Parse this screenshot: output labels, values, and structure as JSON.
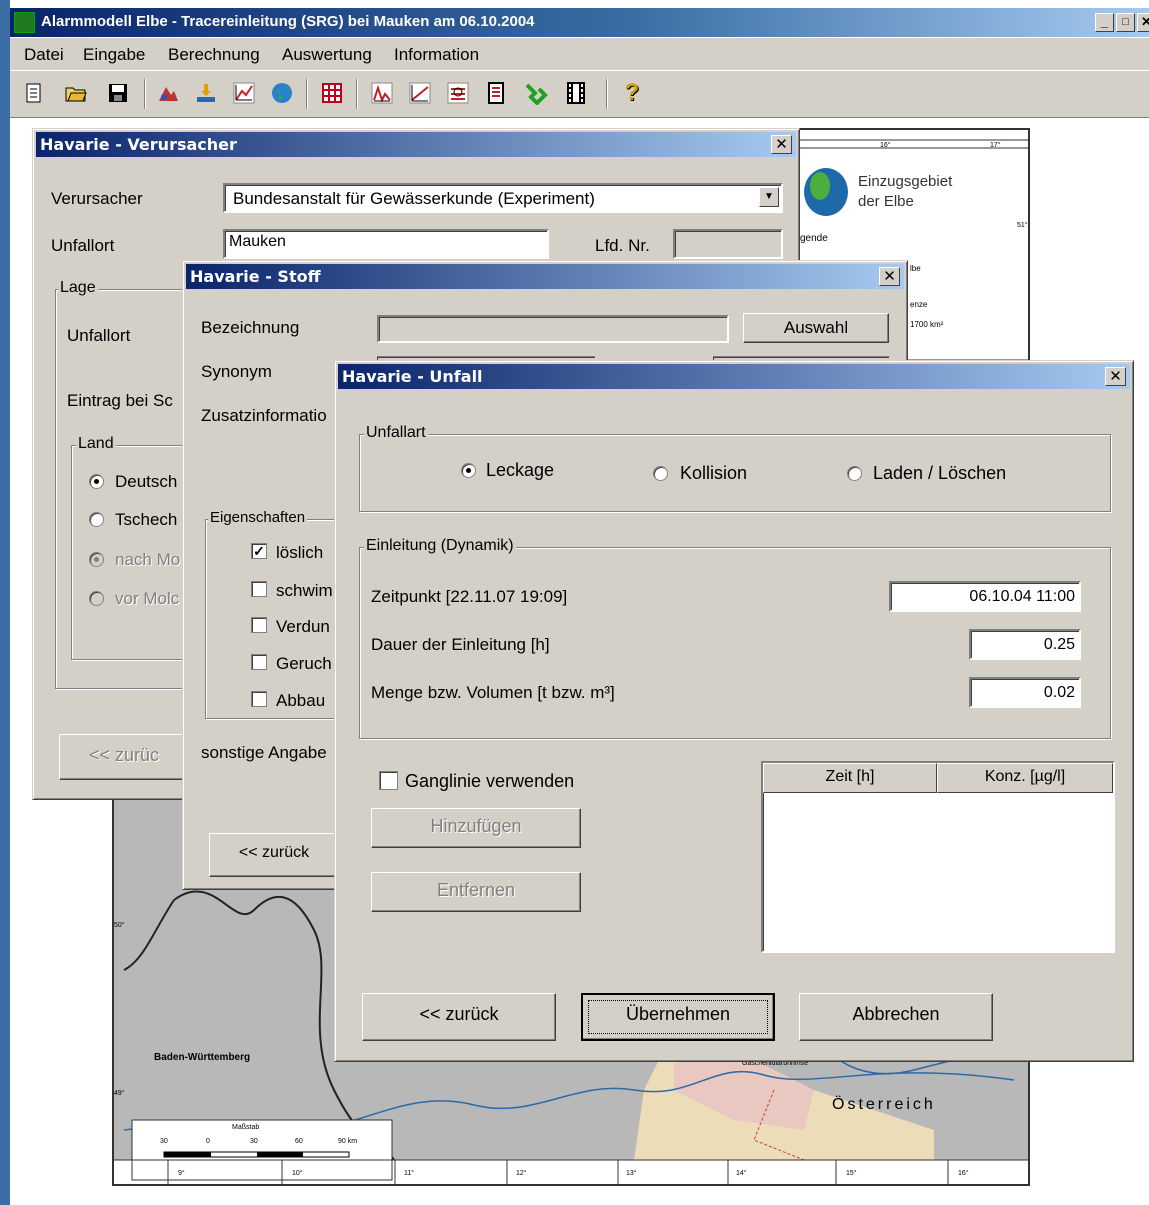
{
  "window": {
    "title": "Alarmmodell Elbe - Tracereinleitung (SRG) bei Mauken am 06.10.2004",
    "min_label": "_",
    "max_label": "□",
    "close_label": "✕"
  },
  "menu": [
    "Datei",
    "Eingabe",
    "Berechnung",
    "Auswertung",
    "Information"
  ],
  "toolbar": {
    "icons": [
      "new-doc-icon",
      "open-folder-icon",
      "save-icon",
      "river-source-icon",
      "inflow-icon",
      "graph-icon",
      "globe-icon",
      "table-icon",
      "chart-peak-icon",
      "chart-line-icon",
      "chart-stack-icon",
      "report-icon",
      "route-icon",
      "film-icon",
      "help-icon"
    ],
    "help_glyph": "?"
  },
  "map": {
    "legend_title_1": "Einzugsgebiet",
    "legend_title_2": "der Elbe",
    "legend_line": "gende",
    "legend_elbe": "lbe",
    "legend_enze": "enze",
    "legend_area": "1700 km²",
    "region_bw": "Baden-Württemberg",
    "region_at": "Österreich",
    "scale_title": "Maßstab",
    "scale_ticks": [
      "30",
      "0",
      "30",
      "60",
      "90 km"
    ],
    "lon_ticks": [
      "9°",
      "10°",
      "11°",
      "12°",
      "13°",
      "14°",
      "15°",
      "16°"
    ],
    "lat_ticks": [
      "50°",
      "49°"
    ],
    "top_ticks": [
      "16°",
      "17°"
    ],
    "lat_right": "51°",
    "city_label": "Gaschenidlarbhrimse"
  },
  "dialog_verursacher": {
    "title": "Havarie - Verursacher",
    "close": "✕",
    "verursacher_label": "Verursacher",
    "verursacher_value": "Bundesanstalt für Gewässerkunde (Experiment)",
    "unfallort_label": "Unfallort",
    "unfallort_value": "Mauken",
    "lfd_label": "Lfd. Nr.",
    "lfd_value": "",
    "lage_group": "Lage",
    "lage_unfallort": "Unfallort",
    "eintrag_label": "Eintrag bei Sc",
    "land_group": "Land",
    "land_options": [
      "Deutsch",
      "Tschech",
      "nach Mo",
      "vor Molc"
    ],
    "back_button": "<< zurüc"
  },
  "dialog_stoff": {
    "title": "Havarie - Stoff",
    "close": "✕",
    "bezeichnung_label": "Bezeichnung",
    "bezeichnung_value": "",
    "auswahl_button": "Auswahl",
    "synonym_label": "Synonym",
    "zusatz_label": "Zusatzinformatio",
    "eigenschaften_group": "Eigenschaften",
    "checks": [
      {
        "label": "löslich",
        "checked": true
      },
      {
        "label": "schwim",
        "checked": false
      },
      {
        "label": "Verdun",
        "checked": false
      },
      {
        "label": "Geruch",
        "checked": false
      },
      {
        "label": "Abbau",
        "checked": false
      }
    ],
    "sonstige_label": "sonstige Angabe",
    "back_button": "<< zurück"
  },
  "dialog_unfall": {
    "title": "Havarie - Unfall",
    "close": "✕",
    "unfallart_group": "Unfallart",
    "unfallart_options": [
      {
        "label": "Leckage",
        "selected": true
      },
      {
        "label": "Kollision",
        "selected": false
      },
      {
        "label": "Laden / Löschen",
        "selected": false
      }
    ],
    "einleitung_group": "Einleitung (Dynamik)",
    "zeitpunkt_label": "Zeitpunkt [22.11.07 19:09]",
    "zeitpunkt_value": "06.10.04 11:00",
    "dauer_label": "Dauer der Einleitung [h]",
    "dauer_value": "0.25",
    "menge_label": "Menge bzw. Volumen [t bzw. m³]",
    "menge_value": "0.02",
    "ganglinie_label": "Ganglinie verwenden",
    "ganglinie_checked": false,
    "add_button": "Hinzufügen",
    "remove_button": "Entfernen",
    "table_headers": [
      "Zeit [h]",
      "Konz. [µg/l]"
    ],
    "back_button": "<< zurück",
    "apply_button": "Übernehmen",
    "cancel_button": "Abbrechen"
  },
  "colors": {
    "title_active": "#0a246a",
    "face": "#d4d0c8",
    "map_land": "#b8b8b8",
    "river": "#2a6aa8"
  }
}
